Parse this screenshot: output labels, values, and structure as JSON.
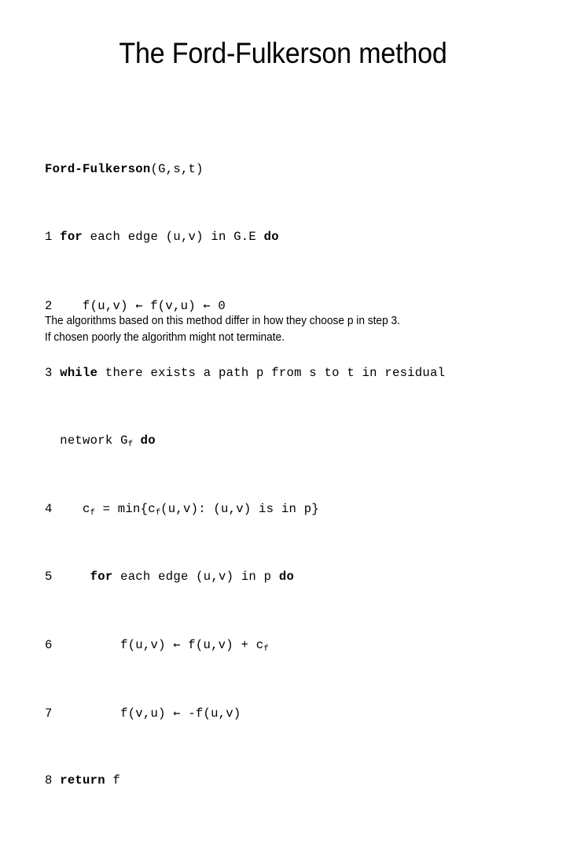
{
  "slide": {
    "title": "The Ford-Fulkerson method",
    "background_color": "#ffffff",
    "text_color": "#000000"
  },
  "pseudocode": {
    "name": "Ford-Fulkerson",
    "signature_args": "(G,s,t)",
    "lines": [
      {
        "number": "",
        "text": "Ford-Fulkerson(G,s,t)"
      },
      {
        "number": "1",
        "text": "for each edge (u,v) in G.E do"
      },
      {
        "number": "2",
        "text": "f(u,v) ← f(v,u) ← 0"
      },
      {
        "number": "3",
        "text": "while there exists a path p from s to t in residual"
      },
      {
        "number": "",
        "text": "network Gƒ do"
      },
      {
        "number": "4",
        "text": "cƒ = min{cƒ(u,v): (u,v) is in p}"
      },
      {
        "number": "5",
        "text": "for each edge (u,v) in p do"
      },
      {
        "number": "6",
        "text": "f(u,v) ← f(u,v) + cƒ"
      },
      {
        "number": "7",
        "text": "f(v,u) ← -f(u,v)"
      },
      {
        "number": "8",
        "text": "return f"
      }
    ],
    "keywords": [
      "for",
      "do",
      "while",
      "return"
    ],
    "arrow_glyph": "←",
    "subscript": "f"
  },
  "code_tokens": {
    "l0_name": "Ford-Fulkerson",
    "l0_args": "(G,s,t)",
    "l1_num": "1",
    "l1_kw": "for",
    "l1_mid": " each edge (u,v) in G.E ",
    "l1_kw2": "do",
    "l2_num": "2",
    "l2_a": "f(u,v) ",
    "l2_arrow1": "←",
    "l2_b": " f(v,u) ",
    "l2_arrow2": "←",
    "l2_c": " 0",
    "l3_num": "3",
    "l3_kw": "while",
    "l3_rest": " there exists a path p from s to t in residual",
    "l3b_a": "network G",
    "l3b_sub": "f",
    "l3b_b": " ",
    "l3b_kw": "do",
    "l4_num": "4",
    "l4_a": "c",
    "l4_sub1": "f",
    "l4_b": " = min{c",
    "l4_sub2": "f",
    "l4_c": "(u,v): (u,v) is in p}",
    "l5_num": "5",
    "l5_kw": "for",
    "l5_rest": " each edge (u,v) in p ",
    "l5_kw2": "do",
    "l6_num": "6",
    "l6_a": "f(u,v) ",
    "l6_arrow": "←",
    "l6_b": " f(u,v) + c",
    "l6_sub": "f",
    "l7_num": "7",
    "l7_a": "f(v,u) ",
    "l7_arrow": "←",
    "l7_b": " -f(u,v)",
    "l8_num": "8",
    "l8_kw": "return",
    "l8_rest": " f"
  },
  "note": {
    "line1": "The algorithms based on this method differ in how they choose p in step 3.",
    "line2": "If chosen poorly the algorithm might not terminate."
  }
}
